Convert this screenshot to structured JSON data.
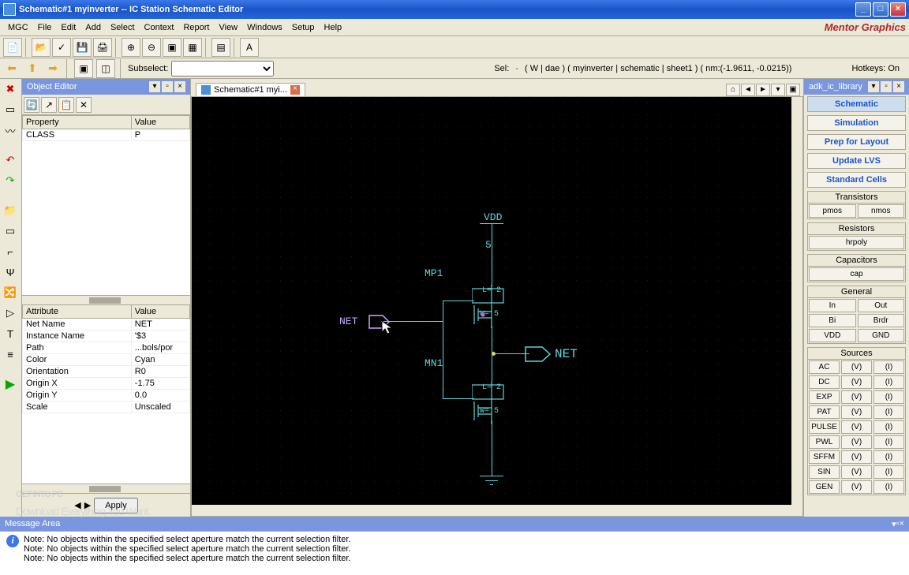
{
  "title": "Schematic#1 myinverter -- IC Station Schematic Editor",
  "menus": [
    "MGC",
    "File",
    "Edit",
    "Add",
    "Select",
    "Context",
    "Report",
    "View",
    "Windows",
    "Setup",
    "Help"
  ],
  "logo": "Mentor Graphics",
  "subselect_label": "Subselect:",
  "sel_label": "Sel:",
  "context": "( W | dae )  ( myinverter | schematic | sheet1 )  ( nm:(-1.9611, -0.0215))",
  "hotkeys": "Hotkeys: On",
  "object_editor_title": "Object Editor",
  "props": {
    "headers": [
      "Property",
      "Value"
    ],
    "rows": [
      [
        "CLASS",
        "P"
      ]
    ]
  },
  "attrs": {
    "headers": [
      "Attribute",
      "Value"
    ],
    "rows": [
      [
        "Net Name",
        "NET"
      ],
      [
        "Instance Name",
        "'$3"
      ],
      [
        "Path",
        "...bols/por"
      ],
      [
        "Color",
        "Cyan"
      ],
      [
        "Orientation",
        "R0"
      ],
      [
        "Origin X",
        "-1.75"
      ],
      [
        "Origin Y",
        "0.0"
      ],
      [
        "Scale",
        "Unscaled"
      ]
    ]
  },
  "apply": "Apply",
  "tab": "Schematic#1 myi...",
  "canvas": {
    "vdd": "VDD",
    "v5": "5",
    "mp1": "MP1",
    "mn1": "MN1",
    "net1": "NET",
    "net2": "NET",
    "l2": "L= 2",
    "w5": "W= 5"
  },
  "rpanel": {
    "title": "adk_ic_library",
    "main": [
      "Schematic",
      "Simulation",
      "Prep for Layout",
      "Update LVS",
      "Standard Cells"
    ],
    "transistors": {
      "t": "Transistors",
      "items": [
        "pmos",
        "nmos"
      ]
    },
    "resistors": {
      "t": "Resistors",
      "items": [
        "hrpoly"
      ]
    },
    "capacitors": {
      "t": "Capacitors",
      "items": [
        "cap"
      ]
    },
    "general": {
      "t": "General",
      "rows": [
        [
          "In",
          "Out"
        ],
        [
          "Bi",
          "Brdr"
        ],
        [
          "VDD",
          "GND"
        ]
      ]
    },
    "sources": {
      "t": "Sources",
      "rows": [
        [
          "AC",
          "(V)",
          "(I)"
        ],
        [
          "DC",
          "(V)",
          "(I)"
        ],
        [
          "EXP",
          "(V)",
          "(I)"
        ],
        [
          "PAT",
          "(V)",
          "(I)"
        ],
        [
          "PULSE",
          "(V)",
          "(I)"
        ],
        [
          "PWL",
          "(V)",
          "(I)"
        ],
        [
          "SFFM",
          "(V)",
          "(I)"
        ],
        [
          "SIN",
          "(V)",
          "(I)"
        ],
        [
          "GEN",
          "(V)",
          "(I)"
        ]
      ]
    }
  },
  "msg_title": "Message Area",
  "messages": [
    "Note: No objects within the specified select aperture match the current selection filter.",
    "Note: No objects within the specified select aperture match the current selection filter.",
    "Note: No objects within the specified select aperture match the current selection filter."
  ],
  "watermark": "GET INTO PC",
  "watermark_sub": "Download Everything You Want"
}
